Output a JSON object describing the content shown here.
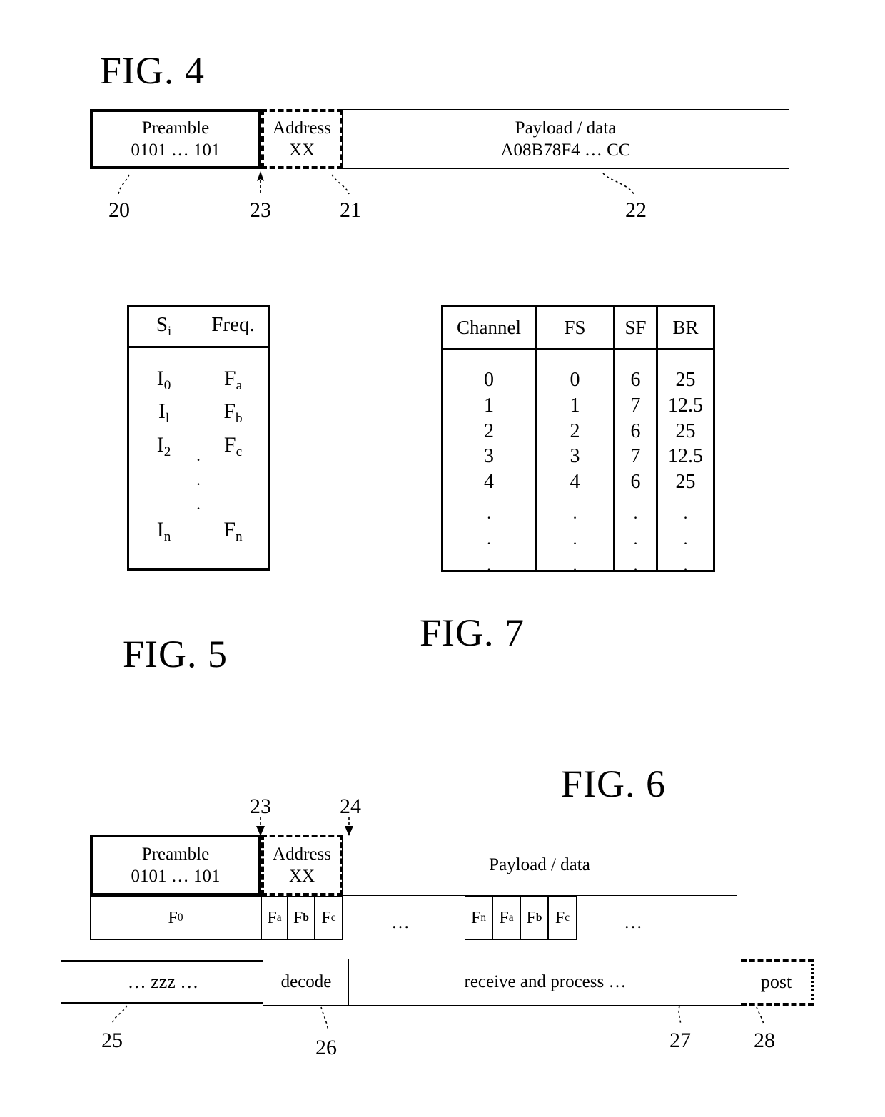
{
  "figures": {
    "fig4": {
      "title": "FIG. 4",
      "packet": {
        "preamble": {
          "line1": "Preamble",
          "line2": "0101 … 101"
        },
        "address": {
          "line1": "Address",
          "line2": "XX"
        },
        "payload": {
          "line1": "Payload / data",
          "line2": "A08B78F4 … CC"
        }
      },
      "refs": {
        "preamble": "20",
        "boundary": "23",
        "address": "21",
        "payload": "22"
      }
    },
    "fig5": {
      "title": "FIG. 5",
      "table": {
        "headers": [
          "S",
          "Freq."
        ],
        "header_sub": [
          "i",
          ""
        ],
        "rows": [
          {
            "symbol": "I",
            "symbol_sub": "0",
            "freq": "F",
            "freq_sub": "a"
          },
          {
            "symbol": "I",
            "symbol_sub": "l",
            "freq": "F",
            "freq_sub": "b"
          },
          {
            "symbol": "I",
            "symbol_sub": "2",
            "freq": "F",
            "freq_sub": "c"
          },
          {
            "symbol": "I",
            "symbol_sub": "n",
            "freq": "F",
            "freq_sub": "n"
          }
        ],
        "vertical_dots": "·\n·\n·"
      }
    },
    "fig7": {
      "title": "FIG. 7",
      "table": {
        "headers": [
          "Channel",
          "FS",
          "SF",
          "BR"
        ],
        "rows": [
          [
            "0",
            "0",
            "6",
            "25"
          ],
          [
            "1",
            "1",
            "7",
            "12.5"
          ],
          [
            "2",
            "2",
            "6",
            "25"
          ],
          [
            "3",
            "3",
            "7",
            "12.5"
          ],
          [
            "4",
            "4",
            "6",
            "25"
          ]
        ],
        "continuation_dots": [
          "·",
          "·",
          "·"
        ]
      }
    },
    "fig6": {
      "title": "FIG. 6",
      "packet": {
        "preamble": {
          "line1": "Preamble",
          "line2": "0101 … 101"
        },
        "address": {
          "line1": "Address",
          "line2": "XX"
        },
        "payload": {
          "line1": "Payload / data",
          "line2": ""
        }
      },
      "freq_row": {
        "base": {
          "sym": "F",
          "sub": "0"
        },
        "group1": [
          {
            "sym": "F",
            "sub": "a"
          },
          {
            "sym": "F",
            "sub": "b"
          },
          {
            "sym": "F",
            "sub": "c"
          }
        ],
        "gap1": "…",
        "group2": [
          {
            "sym": "F",
            "sub": "n"
          },
          {
            "sym": "F",
            "sub": "a"
          },
          {
            "sym": "F",
            "sub": "b"
          },
          {
            "sym": "F",
            "sub": "c"
          }
        ],
        "gap2": "…"
      },
      "timeline": {
        "sleep": "… zzz …",
        "decode": "decode",
        "process": "receive and process …",
        "post": "post"
      },
      "refs": {
        "boundary_23": "23",
        "boundary_24": "24",
        "sleep": "25",
        "decode": "26",
        "process": "27",
        "post": "28"
      }
    }
  },
  "colors": {
    "ink": "#000000",
    "paper": "#ffffff"
  }
}
